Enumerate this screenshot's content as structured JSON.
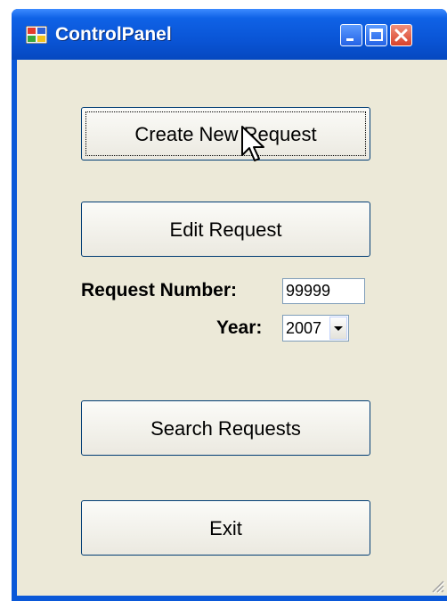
{
  "window": {
    "title": "ControlPanel",
    "icon": "app-window-icon",
    "controls": [
      "minimize-icon",
      "maximize-icon",
      "close-icon"
    ]
  },
  "buttons": {
    "create": "Create New Request",
    "edit": "Edit Request",
    "search": "Search Requests",
    "exit": "Exit"
  },
  "form": {
    "request_number_label": "Request Number:",
    "request_number_value": "99999",
    "year_label": "Year:",
    "year_value": "2007"
  },
  "colors": {
    "titlebar": "#0a55d6",
    "client_bg": "#ece9d8",
    "close_button": "#d8422a"
  }
}
